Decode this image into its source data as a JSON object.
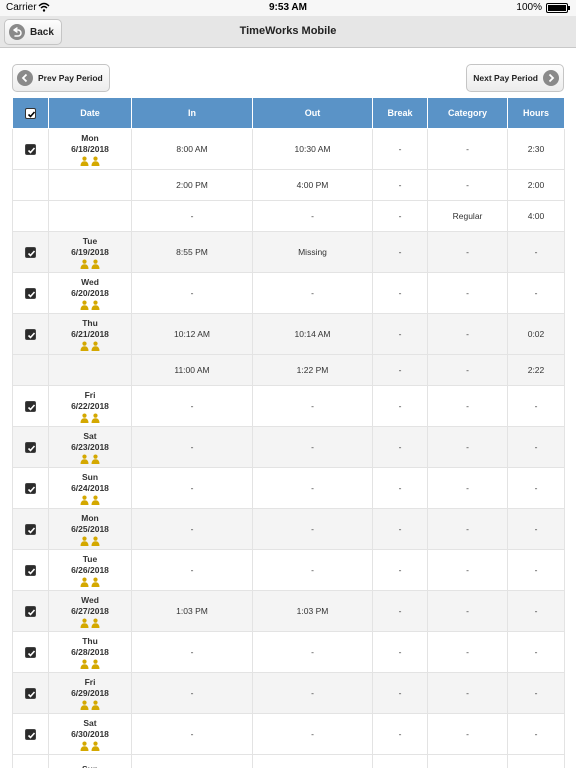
{
  "status": {
    "carrier": "Carrier",
    "time": "9:53 AM",
    "battery": "100%"
  },
  "header": {
    "back_label": "Back",
    "title": "TimeWorks Mobile"
  },
  "pager": {
    "prev_label": "Prev Pay Period",
    "next_label": "Next Pay Period"
  },
  "table": {
    "columns": [
      "Date",
      "In",
      "Out",
      "Break",
      "Category",
      "Hours"
    ],
    "rows": [
      {
        "check": true,
        "day": "Mon",
        "date": "6/18/2018",
        "in": "8:00 AM",
        "out": "10:30 AM",
        "break": "-",
        "category": "-",
        "hours": "2:30"
      },
      {
        "check": false,
        "day": "",
        "date": "",
        "in": "2:00 PM",
        "out": "4:00 PM",
        "break": "-",
        "category": "-",
        "hours": "2:00"
      },
      {
        "check": false,
        "day": "",
        "date": "",
        "in": "-",
        "out": "-",
        "break": "-",
        "category": "Regular",
        "hours": "4:00"
      },
      {
        "check": true,
        "day": "Tue",
        "date": "6/19/2018",
        "in": "8:55 PM",
        "out": "Missing",
        "break": "-",
        "category": "-",
        "hours": "-"
      },
      {
        "check": true,
        "day": "Wed",
        "date": "6/20/2018",
        "in": "-",
        "out": "-",
        "break": "-",
        "category": "-",
        "hours": "-"
      },
      {
        "check": true,
        "day": "Thu",
        "date": "6/21/2018",
        "in": "10:12 AM",
        "out": "10:14 AM",
        "break": "-",
        "category": "-",
        "hours": "0:02"
      },
      {
        "check": false,
        "day": "",
        "date": "",
        "in": "11:00 AM",
        "out": "1:22 PM",
        "break": "-",
        "category": "-",
        "hours": "2:22"
      },
      {
        "check": true,
        "day": "Fri",
        "date": "6/22/2018",
        "in": "-",
        "out": "-",
        "break": "-",
        "category": "-",
        "hours": "-"
      },
      {
        "check": true,
        "day": "Sat",
        "date": "6/23/2018",
        "in": "-",
        "out": "-",
        "break": "-",
        "category": "-",
        "hours": "-"
      },
      {
        "check": true,
        "day": "Sun",
        "date": "6/24/2018",
        "in": "-",
        "out": "-",
        "break": "-",
        "category": "-",
        "hours": "-"
      },
      {
        "check": true,
        "day": "Mon",
        "date": "6/25/2018",
        "in": "-",
        "out": "-",
        "break": "-",
        "category": "-",
        "hours": "-"
      },
      {
        "check": true,
        "day": "Tue",
        "date": "6/26/2018",
        "in": "-",
        "out": "-",
        "break": "-",
        "category": "-",
        "hours": "-"
      },
      {
        "check": true,
        "day": "Wed",
        "date": "6/27/2018",
        "in": "1:03 PM",
        "out": "1:03 PM",
        "break": "-",
        "category": "-",
        "hours": "-"
      },
      {
        "check": true,
        "day": "Thu",
        "date": "6/28/2018",
        "in": "-",
        "out": "-",
        "break": "-",
        "category": "-",
        "hours": "-"
      },
      {
        "check": true,
        "day": "Fri",
        "date": "6/29/2018",
        "in": "-",
        "out": "-",
        "break": "-",
        "category": "-",
        "hours": "-"
      },
      {
        "check": true,
        "day": "Sat",
        "date": "6/30/2018",
        "in": "-",
        "out": "-",
        "break": "-",
        "category": "-",
        "hours": "-"
      },
      {
        "check": true,
        "day": "Sun",
        "date": "",
        "in": "",
        "out": "",
        "break": "",
        "category": "",
        "hours": ""
      }
    ]
  },
  "colors": {
    "header_blue": "#5a93c7",
    "date_blue": "#3b8ed4",
    "missing_red": "#e00000",
    "icon_gold": "#d4a800"
  },
  "icons": {
    "back": "back-arrow-icon",
    "prev": "chevron-left-icon",
    "next": "chevron-right-icon",
    "punch": "clock-in-icon",
    "supervisor": "supervisor-icon"
  }
}
